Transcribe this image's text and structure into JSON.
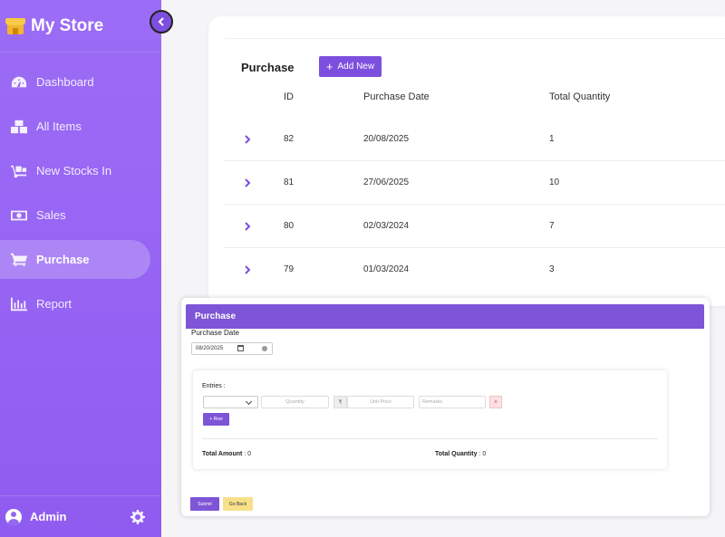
{
  "app": {
    "name": "My Store"
  },
  "sidebar": {
    "items": [
      {
        "label": "Dashboard",
        "icon": "dashboard-gauge-icon"
      },
      {
        "label": "All Items",
        "icon": "boxes-icon"
      },
      {
        "label": "New Stocks In",
        "icon": "dolly-icon"
      },
      {
        "label": "Sales",
        "icon": "money-bill-icon"
      },
      {
        "label": "Purchase",
        "icon": "shopping-cart-icon",
        "active": true
      },
      {
        "label": "Report",
        "icon": "bar-chart-icon"
      }
    ],
    "user": "Admin"
  },
  "purchase_list": {
    "title": "Purchase",
    "add_button": "Add New",
    "columns": [
      "ID",
      "Purchase Date",
      "Total Quantity"
    ],
    "rows": [
      {
        "id": "82",
        "date": "20/08/2025",
        "qty": "1"
      },
      {
        "id": "81",
        "date": "27/06/2025",
        "qty": "10"
      },
      {
        "id": "80",
        "date": "02/03/2024",
        "qty": "7"
      },
      {
        "id": "79",
        "date": "01/03/2024",
        "qty": "3"
      }
    ]
  },
  "purchase_form": {
    "header": "Purchase",
    "date_label": "Purchase Date",
    "date_value": "08/20/2025",
    "entries_label": "Entries :",
    "quantity_placeholder": "Quantity",
    "currency_symbol": "₹",
    "unit_price_placeholder": "Unit Price",
    "remarks_placeholder": "Remarks",
    "delete_symbol": "×",
    "add_row_button": "+ Row",
    "total_amount_label": "Total Amount",
    "total_amount_value": ": 0",
    "total_quantity_label": "Total Quantity",
    "total_quantity_value": ": 0",
    "submit_button": "Submit",
    "back_button": "Go Back"
  },
  "colors": {
    "primary": "#7c4fdf",
    "sidebar": "#9866f4",
    "back_button": "#f7e08a"
  }
}
